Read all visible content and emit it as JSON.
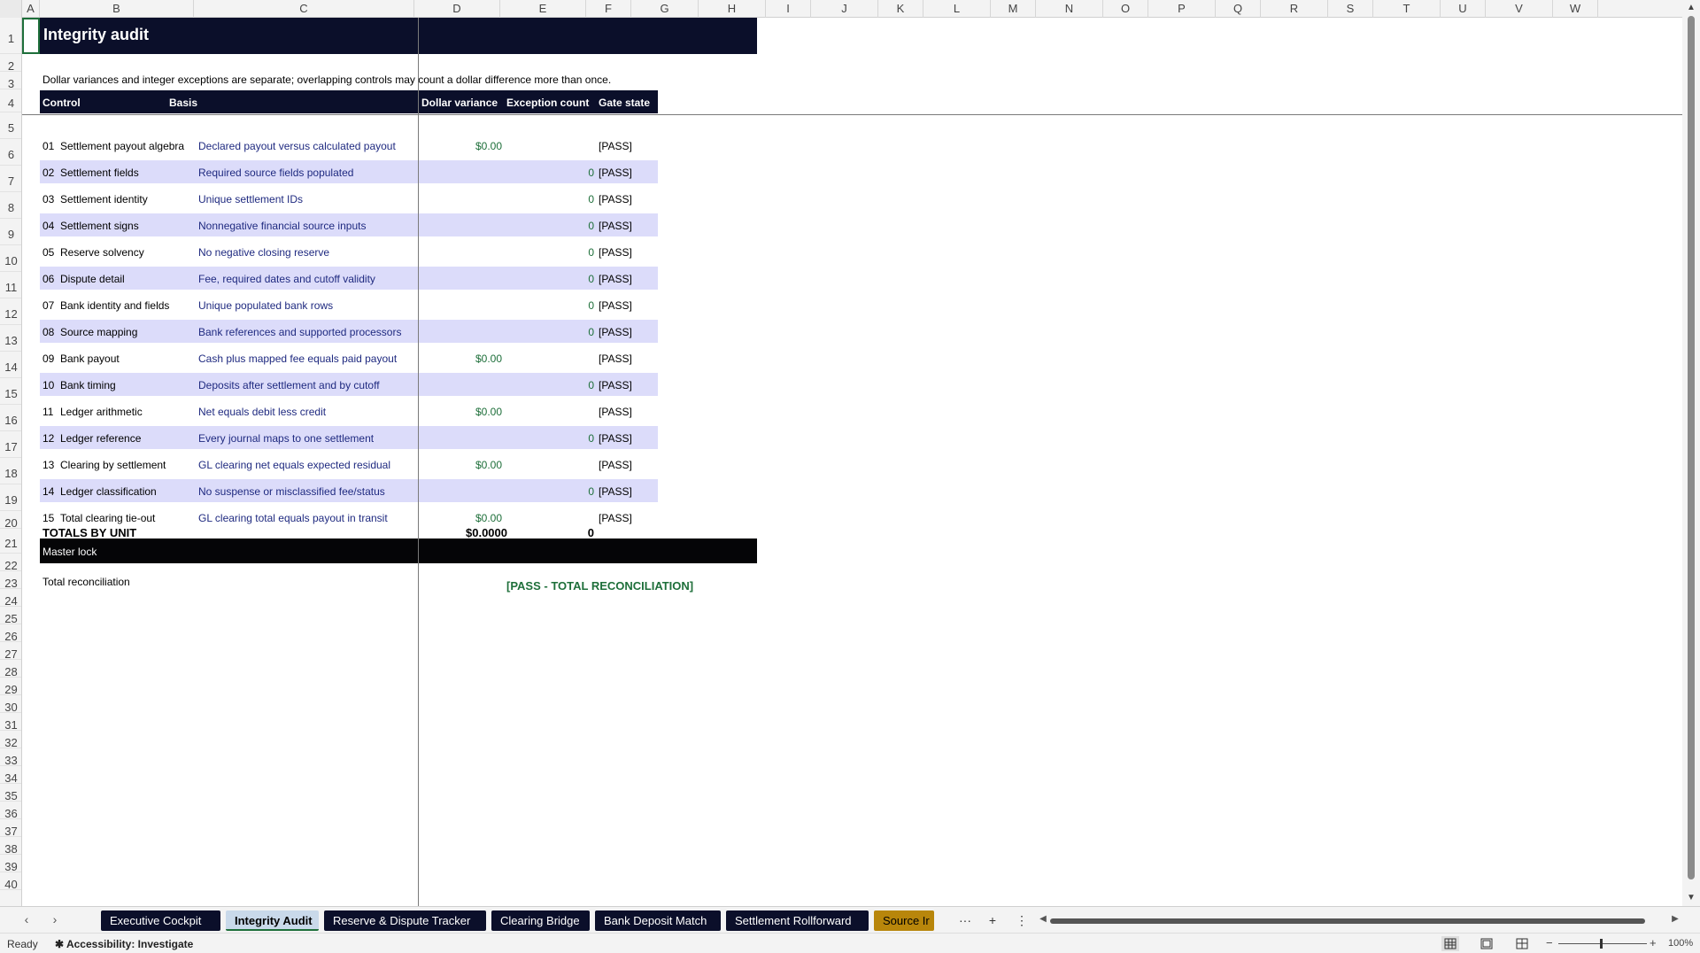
{
  "columns": [
    "A",
    "B",
    "C",
    "D",
    "E",
    "F",
    "G",
    "H",
    "I",
    "J",
    "K",
    "L",
    "M",
    "N",
    "O",
    "P",
    "Q",
    "R",
    "S",
    "T",
    "U",
    "V",
    "W"
  ],
  "rows": [
    "1",
    "2",
    "3",
    "4",
    "5",
    "6",
    "7",
    "8",
    "9",
    "10",
    "11",
    "12",
    "13",
    "14",
    "15",
    "16",
    "17",
    "18",
    "19",
    "20",
    "21",
    "22",
    "23",
    "24",
    "25",
    "26",
    "27",
    "28",
    "29",
    "30",
    "31",
    "32",
    "33",
    "34",
    "35",
    "36",
    "37",
    "38",
    "39",
    "40"
  ],
  "sheet": {
    "title": "Integrity audit",
    "note": "Dollar variances and integer exceptions are separate; overlapping controls may count a dollar difference more than once.",
    "headers": {
      "control": "Control",
      "basis": "Basis",
      "dollar_variance": "Dollar variance",
      "exception_count": "Exception count",
      "gate_state": "Gate state"
    },
    "controls": [
      {
        "num": "01",
        "control": "Settlement payout algebra",
        "basis": "Declared payout versus calculated payout",
        "dollar_variance": "$0.00",
        "exception_count": "",
        "gate": "[PASS]"
      },
      {
        "num": "02",
        "control": "Settlement fields",
        "basis": "Required source fields populated",
        "dollar_variance": "",
        "exception_count": "0",
        "gate": "[PASS]"
      },
      {
        "num": "03",
        "control": "Settlement identity",
        "basis": "Unique settlement IDs",
        "dollar_variance": "",
        "exception_count": "0",
        "gate": "[PASS]"
      },
      {
        "num": "04",
        "control": "Settlement signs",
        "basis": "Nonnegative financial source inputs",
        "dollar_variance": "",
        "exception_count": "0",
        "gate": "[PASS]"
      },
      {
        "num": "05",
        "control": "Reserve solvency",
        "basis": "No negative closing reserve",
        "dollar_variance": "",
        "exception_count": "0",
        "gate": "[PASS]"
      },
      {
        "num": "06",
        "control": "Dispute detail",
        "basis": "Fee, required dates and cutoff validity",
        "dollar_variance": "",
        "exception_count": "0",
        "gate": "[PASS]"
      },
      {
        "num": "07",
        "control": "Bank identity and fields",
        "basis": "Unique populated bank rows",
        "dollar_variance": "",
        "exception_count": "0",
        "gate": "[PASS]"
      },
      {
        "num": "08",
        "control": "Source mapping",
        "basis": "Bank references and supported processors",
        "dollar_variance": "",
        "exception_count": "0",
        "gate": "[PASS]"
      },
      {
        "num": "09",
        "control": "Bank payout",
        "basis": "Cash plus mapped fee equals paid payout",
        "dollar_variance": "$0.00",
        "exception_count": "",
        "gate": "[PASS]"
      },
      {
        "num": "10",
        "control": "Bank timing",
        "basis": "Deposits after settlement and by cutoff",
        "dollar_variance": "",
        "exception_count": "0",
        "gate": "[PASS]"
      },
      {
        "num": "11",
        "control": "Ledger arithmetic",
        "basis": "Net equals debit less credit",
        "dollar_variance": "$0.00",
        "exception_count": "",
        "gate": "[PASS]"
      },
      {
        "num": "12",
        "control": "Ledger reference",
        "basis": "Every journal maps to one settlement",
        "dollar_variance": "",
        "exception_count": "0",
        "gate": "[PASS]"
      },
      {
        "num": "13",
        "control": "Clearing by settlement",
        "basis": "GL clearing net equals expected residual",
        "dollar_variance": "$0.00",
        "exception_count": "",
        "gate": "[PASS]"
      },
      {
        "num": "14",
        "control": "Ledger classification",
        "basis": "No suspense or misclassified fee/status",
        "dollar_variance": "",
        "exception_count": "0",
        "gate": "[PASS]"
      },
      {
        "num": "15",
        "control": "Total clearing tie-out",
        "basis": "GL clearing total equals payout in transit",
        "dollar_variance": "$0.00",
        "exception_count": "",
        "gate": "[PASS]"
      }
    ],
    "totals": {
      "label": "TOTALS BY UNIT",
      "dollar": "$0.0000",
      "count": "0"
    },
    "master_lock": "Master lock",
    "total_reconciliation": {
      "label": "Total reconciliation",
      "result": "[PASS - TOTAL RECONCILIATION]"
    }
  },
  "tabs": [
    {
      "label": "Executive Cockpit",
      "active": false
    },
    {
      "label": "Integrity Audit",
      "active": true
    },
    {
      "label": "Reserve & Dispute Tracker",
      "active": false
    },
    {
      "label": "Clearing Bridge",
      "active": false
    },
    {
      "label": "Bank Deposit Match",
      "active": false
    },
    {
      "label": "Settlement Rollforward",
      "active": false
    },
    {
      "label": "Source Ir",
      "active": false
    }
  ],
  "tab_tools": {
    "more": "···",
    "add": "+",
    "options": "⋮"
  },
  "status": {
    "ready": "Ready",
    "accessibility": "Accessibility: Investigate",
    "zoom": "100%"
  },
  "colors": {
    "navy": "#0b0f2a",
    "band": "#dcdcfa",
    "green": "#1e6f3a",
    "orange_tab": "#b8860b"
  }
}
